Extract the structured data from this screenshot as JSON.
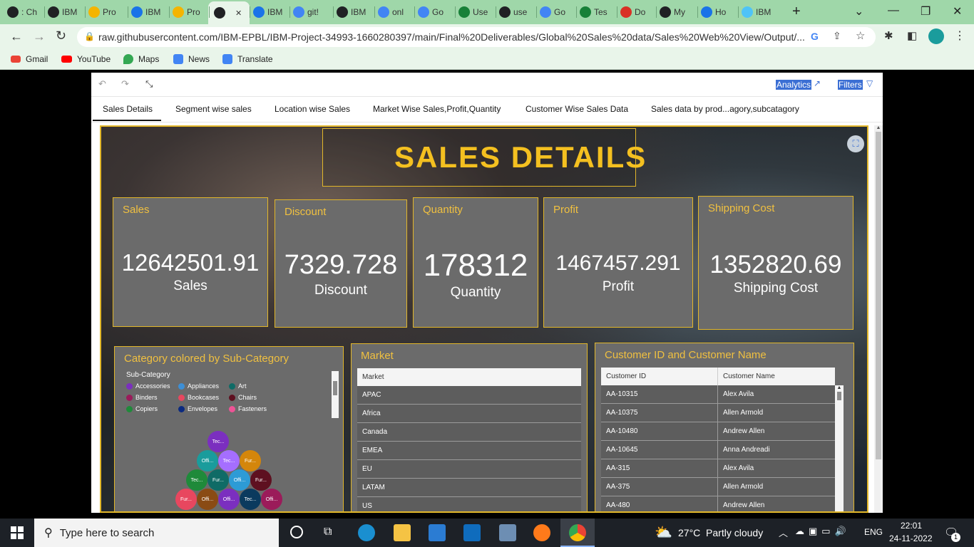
{
  "browser": {
    "tabs": [
      {
        "label": ": Ch",
        "icon": "chrome-icon",
        "color": "#202124"
      },
      {
        "label": "IBM",
        "icon": "globe-icon",
        "color": "#202124"
      },
      {
        "label": "Pro",
        "icon": "drive-icon",
        "color": "#f4b400"
      },
      {
        "label": "IBM",
        "icon": "docs-icon",
        "color": "#1a73e8"
      },
      {
        "label": "Pro",
        "icon": "drive-icon",
        "color": "#f4b400"
      },
      {
        "label": "",
        "icon": "globe-icon",
        "color": "#202124",
        "active": true
      },
      {
        "label": "IBM",
        "icon": "docs-icon",
        "color": "#1a73e8"
      },
      {
        "label": "git!",
        "icon": "google-icon",
        "color": "#4285f4"
      },
      {
        "label": "IBM",
        "icon": "github-icon",
        "color": "#202124"
      },
      {
        "label": "onl",
        "icon": "google-icon",
        "color": "#4285f4"
      },
      {
        "label": "Go",
        "icon": "google-icon",
        "color": "#4285f4"
      },
      {
        "label": "Use",
        "icon": "sheets-icon",
        "color": "#188038"
      },
      {
        "label": "use",
        "icon": "globe-icon",
        "color": "#202124"
      },
      {
        "label": "Go",
        "icon": "google-icon",
        "color": "#4285f4"
      },
      {
        "label": "Tes",
        "icon": "sheets-icon",
        "color": "#188038"
      },
      {
        "label": "Do",
        "icon": "heart-icon",
        "color": "#d93025"
      },
      {
        "label": "My",
        "icon": "cloud-icon",
        "color": "#202124"
      },
      {
        "label": "Ho",
        "icon": "list-icon",
        "color": "#1a73e8"
      },
      {
        "label": "IBM",
        "icon": "ibm-cloud-icon",
        "color": "#4fc3f7"
      }
    ],
    "url": "raw.githubusercontent.com/IBM-EPBL/IBM-Project-34993-1660280397/main/Final%20Deliverables/Global%20Sales%20data/Sales%20Web%20View/Output/...",
    "bookmarks": [
      "Gmail",
      "YouTube",
      "Maps",
      "News",
      "Translate"
    ]
  },
  "report": {
    "toolbar": {
      "analytics": "Analytics",
      "filters": "Filters"
    },
    "tabs": [
      "Sales Details",
      "Segment wise sales",
      "Location wise Sales",
      "Market Wise Sales,Profit,Quantity",
      "Customer Wise Sales Data",
      "Sales data by prod...agory,subcatagory"
    ],
    "title": "SALES  DETAILS",
    "kpis": [
      {
        "title": "Sales",
        "value": "12642501.91",
        "label": "Sales"
      },
      {
        "title": "Discount",
        "value": "7329.728",
        "label": "Discount"
      },
      {
        "title": "Quantity",
        "value": "178312",
        "label": "Quantity"
      },
      {
        "title": "Profit",
        "value": "1467457.291",
        "label": "Profit"
      },
      {
        "title": "Shipping Cost",
        "value": "1352820.69",
        "label": "Shipping Cost"
      }
    ],
    "category_panel": {
      "title": "Category colored by Sub-Category",
      "legend_title": "Sub-Category",
      "legend": [
        {
          "label": "Accessories",
          "color": "#7b2fbf"
        },
        {
          "label": "Appliances",
          "color": "#3d8fd6"
        },
        {
          "label": "Art",
          "color": "#0f6b66"
        },
        {
          "label": "Binders",
          "color": "#9b1b5a"
        },
        {
          "label": "Bookcases",
          "color": "#e8475f"
        },
        {
          "label": "Chairs",
          "color": "#5e1020"
        },
        {
          "label": "Copiers",
          "color": "#1f8a3a"
        },
        {
          "label": "Envelopes",
          "color": "#0b2a80"
        },
        {
          "label": "Fasteners",
          "color": "#ee5396"
        }
      ],
      "bubbles": [
        {
          "label": "Tec...",
          "color": "#7b2fbf"
        },
        {
          "label": "Offi...",
          "color": "#1a9c9c"
        },
        {
          "label": "Tec...",
          "color": "#a56eff"
        },
        {
          "label": "Fur...",
          "color": "#d4860b"
        },
        {
          "label": "Tec...",
          "color": "#1f8a3a"
        },
        {
          "label": "Fur...",
          "color": "#0f6b66"
        },
        {
          "label": "Offi...",
          "color": "#2d9bd6"
        },
        {
          "label": "Fur...",
          "color": "#5e1020"
        },
        {
          "label": "Fur...",
          "color": "#e8475f"
        },
        {
          "label": "Offi...",
          "color": "#8a4b14"
        },
        {
          "label": "Offi...",
          "color": "#7b2fbf"
        },
        {
          "label": "Tec...",
          "color": "#0b3a5e"
        },
        {
          "label": "Offi...",
          "color": "#9b1b5a"
        }
      ]
    },
    "market_panel": {
      "title": "Market",
      "header": "Market",
      "rows": [
        "APAC",
        "Africa",
        "Canada",
        "EMEA",
        "EU",
        "LATAM",
        "US"
      ]
    },
    "customer_panel": {
      "title": "Customer ID and Customer Name",
      "headers": [
        "Customer ID",
        "Customer Name"
      ],
      "rows": [
        [
          "AA-10315",
          "Alex Avila"
        ],
        [
          "AA-10375",
          "Allen Armold"
        ],
        [
          "AA-10480",
          "Andrew Allen"
        ],
        [
          "AA-10645",
          "Anna Andreadi"
        ],
        [
          "AA-315",
          "Alex Avila"
        ],
        [
          "AA-375",
          "Allen Armold"
        ],
        [
          "AA-480",
          "Andrew Allen"
        ]
      ]
    }
  },
  "taskbar": {
    "search_placeholder": "Type here to search",
    "weather": "27°C  Partly cloudy",
    "lang": "ENG",
    "time": "22:01",
    "date": "24-11-2022",
    "notifications": "1"
  }
}
